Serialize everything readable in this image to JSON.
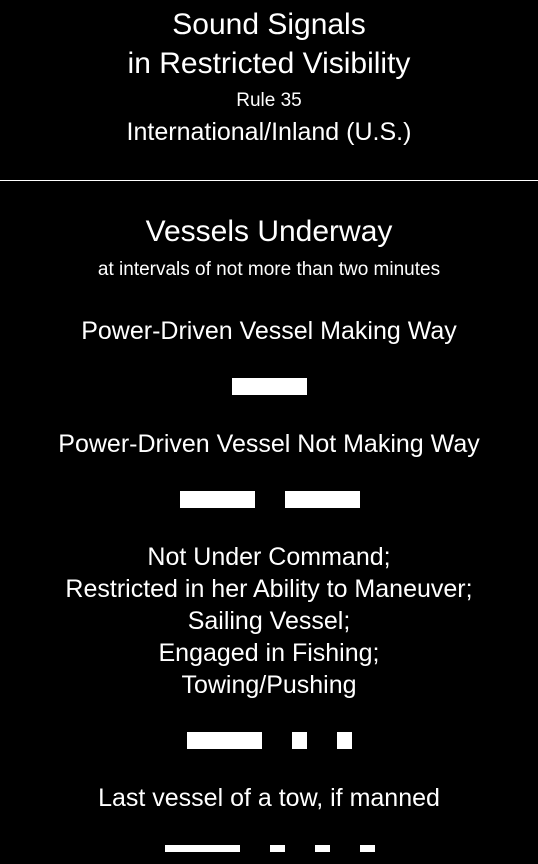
{
  "header": {
    "title_line1": "Sound Signals",
    "title_line2": "in Restricted Visibility",
    "rule": "Rule 35",
    "jurisdiction": "International/Inland (U.S.)"
  },
  "section": {
    "title": "Vessels Underway",
    "subtitle": "at intervals of not more than two minutes"
  },
  "signals": [
    {
      "label": "Power-Driven Vessel Making Way",
      "pattern": [
        "prolonged"
      ]
    },
    {
      "label": "Power-Driven Vessel Not Making Way",
      "pattern": [
        "prolonged",
        "prolonged"
      ]
    },
    {
      "label_lines": [
        "Not Under Command;",
        "Restricted in her Ability to Maneuver;",
        "Sailing Vessel;",
        "Engaged in Fishing;",
        "Towing/Pushing"
      ],
      "pattern": [
        "prolonged",
        "short",
        "short"
      ]
    },
    {
      "label": "Last vessel of a tow, if manned",
      "pattern": [
        "prolonged",
        "short",
        "short",
        "short"
      ]
    }
  ]
}
